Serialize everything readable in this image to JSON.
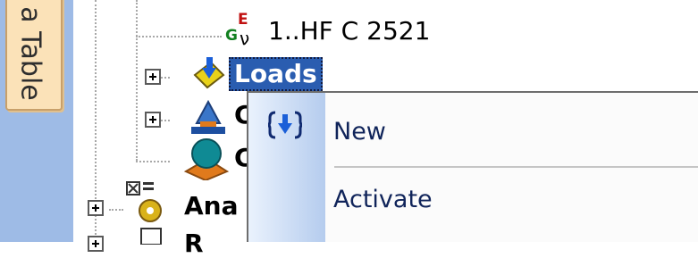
{
  "side_tab": {
    "label": "a Table"
  },
  "tree": {
    "items": [
      {
        "label": "1..HF C 2521",
        "icon": "load-case-icon"
      },
      {
        "label": "Loads",
        "icon": "loads-icon",
        "selected": true
      },
      {
        "label": "C",
        "icon": "support-icon"
      },
      {
        "label": "C",
        "icon": "sphere-icon"
      },
      {
        "label": "Ana",
        "icon": "analysis-icon"
      },
      {
        "label": "R",
        "icon": "document-icon"
      }
    ],
    "load_case_icon_letters": {
      "top": "E",
      "left": "G",
      "sub": "ν"
    }
  },
  "context_menu": {
    "items": [
      {
        "label": "New",
        "icon": "new-load-icon"
      },
      {
        "label": "Activate"
      }
    ]
  },
  "colors": {
    "selection": "#2a5db0",
    "menu_text": "#10245a",
    "strip": "#9ebbe6",
    "tab": "#fbe2b8"
  }
}
